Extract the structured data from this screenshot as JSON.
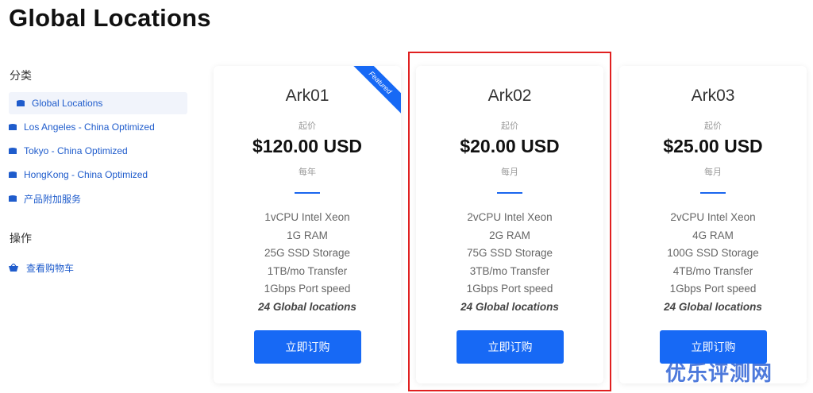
{
  "page": {
    "title": "Global Locations"
  },
  "sidebar": {
    "category_heading": "分类",
    "categories": [
      {
        "label": "Global Locations",
        "active": true
      },
      {
        "label": "Los Angeles - China Optimized",
        "active": false
      },
      {
        "label": "Tokyo - China Optimized",
        "active": false
      },
      {
        "label": "HongKong - China Optimized",
        "active": false
      },
      {
        "label": "产品附加服务",
        "active": false
      }
    ],
    "actions_heading": "操作",
    "actions": [
      {
        "label": "查看购物车",
        "icon": "basket-icon"
      }
    ]
  },
  "products": [
    {
      "name": "Ark01",
      "start_label": "起价",
      "price": "$120.00 USD",
      "cycle": "每年",
      "features": [
        "1vCPU Intel Xeon",
        "1G RAM",
        "25G SSD Storage",
        "1TB/mo Transfer",
        "1Gbps Port speed"
      ],
      "locations": "24 Global locations",
      "button": "立即订购",
      "featured_badge": "Featured"
    },
    {
      "name": "Ark02",
      "start_label": "起价",
      "price": "$20.00 USD",
      "cycle": "每月",
      "features": [
        "2vCPU Intel Xeon",
        "2G RAM",
        "75G SSD Storage",
        "3TB/mo Transfer",
        "1Gbps Port speed"
      ],
      "locations": "24 Global locations",
      "button": "立即订购"
    },
    {
      "name": "Ark03",
      "start_label": "起价",
      "price": "$25.00 USD",
      "cycle": "每月",
      "features": [
        "2vCPU Intel Xeon",
        "4G RAM",
        "100G SSD Storage",
        "4TB/mo Transfer",
        "1Gbps Port speed"
      ],
      "locations": "24 Global locations",
      "button": "立即订购"
    }
  ],
  "watermark": "优乐评测网",
  "colors": {
    "accent": "#1769f5",
    "link": "#1f5ccc",
    "highlight": "#e02020"
  }
}
